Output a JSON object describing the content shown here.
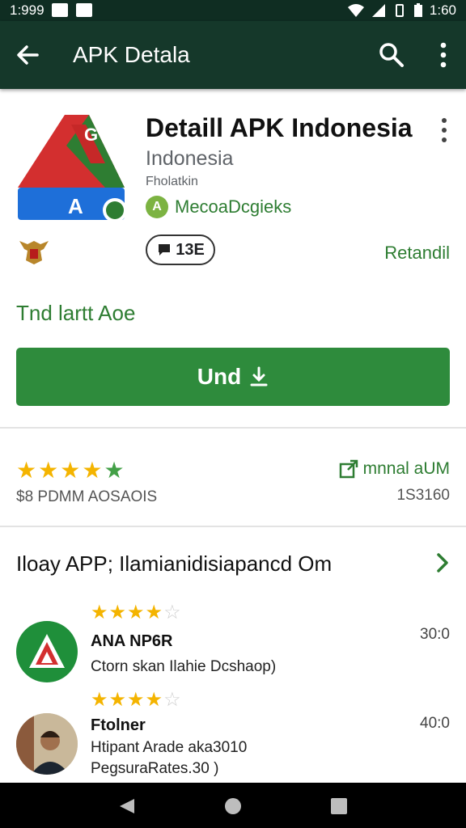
{
  "status_bar": {
    "time_left": "1:999",
    "time_right": "1:60",
    "icons": [
      "notification-icon",
      "mail-icon",
      "wifi-icon",
      "signal-icon",
      "vibrate-icon",
      "battery-icon"
    ]
  },
  "app_bar": {
    "title": "APK Detala",
    "icons": [
      "back-arrow-icon",
      "search-icon",
      "overflow-menu-icon"
    ]
  },
  "app": {
    "title": "Detaill APK Indonesia",
    "subtitle": "Indonesia",
    "category": "Fholatkin",
    "developer": "MecoaDcgieks",
    "badge_count": "13E",
    "reinstall_label": "Retandil",
    "status_text": "Tnd lartt Aoe",
    "install_button_label": "Und"
  },
  "rating": {
    "stars": 4.5,
    "caption": "$8 PDMM AOSAOIS",
    "update_label": "mnnal aUM",
    "update_count": "1S3160"
  },
  "reviews": {
    "header": "Iloay APP; Ilamianidisiapancd Om",
    "items": [
      {
        "stars": 3.5,
        "name": "ANA NP6R",
        "text_line1": "Ctorn skan Ilahie Dcshaop)",
        "text_line2": "",
        "score": "30:0"
      },
      {
        "stars": 3.5,
        "name": "Ftolner",
        "text_line1": "Htipant Arade aka3010",
        "text_line2": "PegsuraRates.30 )",
        "score": "40:0"
      }
    ]
  },
  "colors": {
    "status_bar": "#0f2d22",
    "app_bar": "#15382a",
    "accent_green": "#2e7d32",
    "install_button": "#2e8b3c",
    "star_gold": "#f4b400"
  }
}
